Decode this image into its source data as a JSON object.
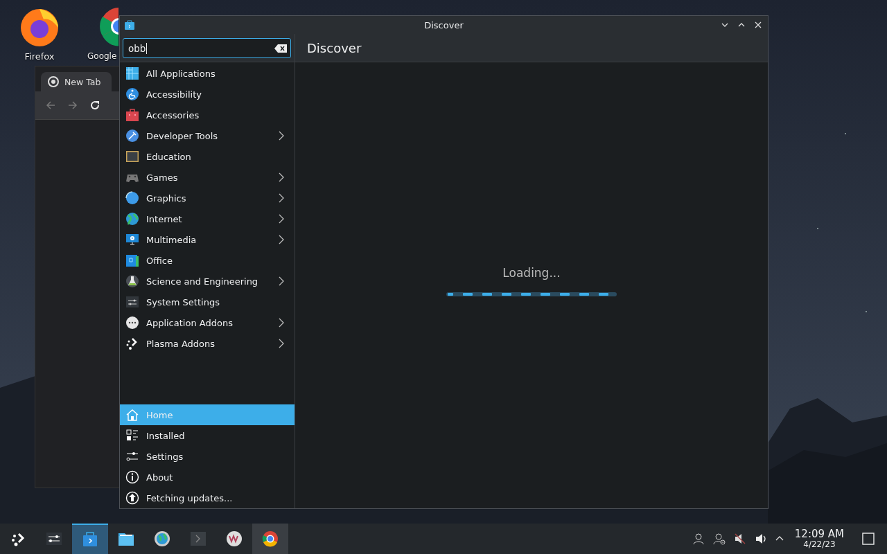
{
  "desktop_icons": [
    {
      "label": "Firefox"
    },
    {
      "label": "Google"
    }
  ],
  "browser_window": {
    "tab": "New Tab"
  },
  "window": {
    "title": "Discover"
  },
  "search": {
    "value": "obb"
  },
  "header": {
    "title": "Discover"
  },
  "categories": [
    {
      "label": "All Applications",
      "expandable": false
    },
    {
      "label": "Accessibility",
      "expandable": false
    },
    {
      "label": "Accessories",
      "expandable": false
    },
    {
      "label": "Developer Tools",
      "expandable": true
    },
    {
      "label": "Education",
      "expandable": false
    },
    {
      "label": "Games",
      "expandable": true
    },
    {
      "label": "Graphics",
      "expandable": true
    },
    {
      "label": "Internet",
      "expandable": true
    },
    {
      "label": "Multimedia",
      "expandable": true
    },
    {
      "label": "Office",
      "expandable": false
    },
    {
      "label": "Science and Engineering",
      "expandable": true
    },
    {
      "label": "System Settings",
      "expandable": false
    },
    {
      "label": "Application Addons",
      "expandable": true
    },
    {
      "label": "Plasma Addons",
      "expandable": true
    }
  ],
  "nav": [
    {
      "label": "Home",
      "selected": true
    },
    {
      "label": "Installed",
      "selected": false
    },
    {
      "label": "Settings",
      "selected": false
    },
    {
      "label": "About",
      "selected": false
    },
    {
      "label": "Fetching updates...",
      "selected": false
    }
  ],
  "content": {
    "status": "Loading..."
  },
  "taskbar": {
    "items": [
      {
        "focused": false,
        "open": false
      },
      {
        "focused": false,
        "open": false
      },
      {
        "focused": true,
        "open": true
      },
      {
        "focused": false,
        "open": false
      },
      {
        "focused": false,
        "open": false
      },
      {
        "focused": false,
        "open": false
      },
      {
        "focused": false,
        "open": false
      },
      {
        "focused": false,
        "open": true
      }
    ],
    "clock": {
      "time": "12:09 AM",
      "date": "4/22/23"
    }
  }
}
